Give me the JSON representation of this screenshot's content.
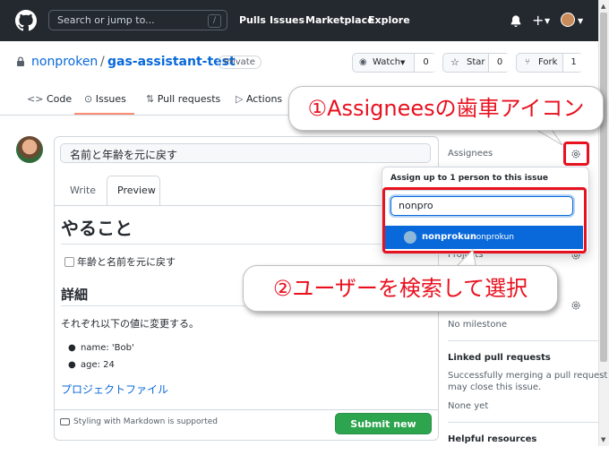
{
  "header": {
    "search_placeholder": "Search or jump to...",
    "search_key": "/",
    "nav": [
      "Pulls",
      "Issues",
      "Marketplace",
      "Explore"
    ]
  },
  "repo": {
    "owner": "nonproken",
    "separator": "/",
    "name": "gas-assistant-test",
    "visibility": "Private",
    "watch_label": "Watch",
    "watch_count": "0",
    "star_label": "Star",
    "star_count": "0",
    "fork_label": "Fork",
    "fork_count": "1"
  },
  "tabs": [
    {
      "label": "Code",
      "icon": "code-icon"
    },
    {
      "label": "Issues",
      "icon": "issue-icon",
      "active": true
    },
    {
      "label": "Pull requests",
      "icon": "pull-request-icon"
    },
    {
      "label": "Actions",
      "icon": "play-icon"
    }
  ],
  "editor": {
    "title_value": "名前と年齢を元に戻す",
    "write_tab": "Write",
    "preview_tab": "Preview",
    "heading1": "やること",
    "task": "年齢と名前を元に戻す",
    "heading2": "詳細",
    "paragraph": "それぞれ以下の値に変更する。",
    "bullets": [
      "name: 'Bob'",
      "age: 24"
    ],
    "link": "プロジェクトファイル",
    "markdown_note": "Styling with Markdown is supported",
    "submit_label": "Submit new issue"
  },
  "sidebar": {
    "assignees_label": "Assignees",
    "projects_label": "Projects",
    "milestone_value": "No milestone",
    "linked_pr_label": "Linked pull requests",
    "linked_pr_text_1": "Successfully merging a pull request",
    "linked_pr_text_2": "may close this issue.",
    "linked_pr_none": "None yet",
    "helpful_label": "Helpful resources"
  },
  "assignee_popup": {
    "header": "Assign up to 1 person to this issue",
    "filter_value": "nonpro",
    "result_login": "nonprokun",
    "result_name": "nonprokun"
  },
  "annotations": {
    "callout1": "①Assigneesの歯車アイコン",
    "callout2": "②ユーザーを検索して選択"
  },
  "colors": {
    "header_bg": "#24292f",
    "link": "#0969da",
    "submit": "#2da44e",
    "highlight_red": "#e8111f",
    "selected_row": "#0969da"
  }
}
